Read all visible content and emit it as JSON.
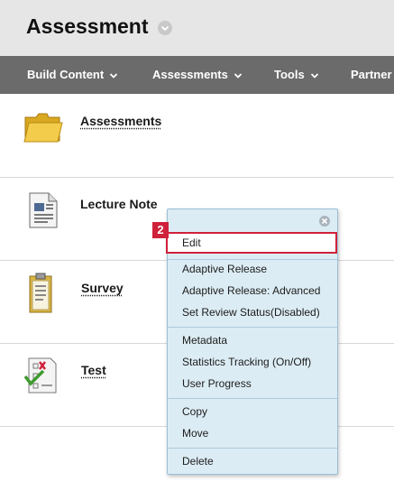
{
  "page": {
    "title": "Assessment"
  },
  "toolbar": {
    "items": [
      {
        "label": "Build Content",
        "has_dropdown": true
      },
      {
        "label": "Assessments",
        "has_dropdown": true
      },
      {
        "label": "Tools",
        "has_dropdown": true
      },
      {
        "label": "Partner",
        "has_dropdown": false
      }
    ]
  },
  "content_items": [
    {
      "title": "Assessments",
      "icon": "folder-icon",
      "is_link": true
    },
    {
      "title": "Lecture Note",
      "icon": "document-icon",
      "is_link": false
    },
    {
      "title": "Survey",
      "icon": "survey-icon",
      "is_link": true
    },
    {
      "title": "Test",
      "icon": "test-icon",
      "is_link": true
    }
  ],
  "context_menu": {
    "step_badge": "2",
    "groups": [
      [
        "Edit"
      ],
      [
        "Adaptive Release",
        "Adaptive Release: Advanced",
        "Set Review Status(Disabled)"
      ],
      [
        "Metadata",
        "Statistics Tracking (On/Off)",
        "User Progress"
      ],
      [
        "Copy",
        "Move"
      ],
      [
        "Delete"
      ]
    ],
    "highlighted_item": "Edit"
  },
  "colors": {
    "header_bg": "#e6e6e6",
    "toolbar_bg": "#6b6b6b",
    "menu_bg": "#dcecf4",
    "highlight": "#d0213a"
  }
}
